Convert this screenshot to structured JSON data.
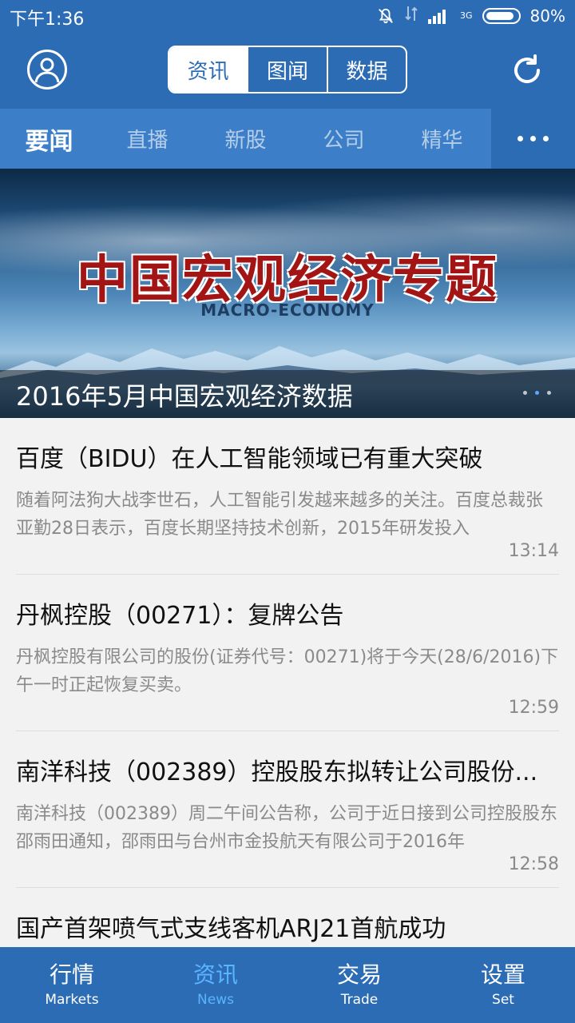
{
  "status_bar": {
    "time": "下午1:36",
    "network": "3G",
    "battery": "80%",
    "icons": [
      "bell-mute-icon",
      "data-arrows-icon",
      "signal-icon",
      "battery-icon"
    ]
  },
  "header": {
    "segments": [
      "资讯",
      "图闻",
      "数据"
    ],
    "active_segment": "资讯",
    "icons": [
      "user-icon",
      "refresh-icon"
    ]
  },
  "categories": {
    "tabs": [
      "要闻",
      "直播",
      "新股",
      "公司",
      "精华"
    ],
    "active_tab": "要闻",
    "more_icon": "more-dots-icon"
  },
  "banner": {
    "title": "中国宏观经济专题",
    "subtitle": "MACRO-ECONOMY",
    "caption": "2016年5月中国宏观经济数据",
    "slide_index": 2,
    "slide_count": 3
  },
  "news": [
    {
      "title": "百度（BIDU）在人工智能领域已有重大突破",
      "summary": "随着阿法狗大战李世石，人工智能引发越来越多的关注。百度总裁张亚勤28日表示，百度长期坚持技术创新，2015年研发投入",
      "time": "13:14"
    },
    {
      "title": "丹枫控股（00271）：复牌公告",
      "summary": "丹枫控股有限公司的股份(证券代号：00271)将于今天(28/6/2016)下午一时正起恢复买卖。",
      "time": "12:59"
    },
    {
      "title": "南洋科技（002389）控股股东拟转让公司股份...",
      "summary": "南洋科技（002389）周二午间公告称，公司于近日接到公司控股股东邵雨田通知，邵雨田与台州市金投航天有限公司于2016年",
      "time": "12:58"
    },
    {
      "title": "国产首架喷气式支线客机ARJ21首航成功",
      "summary": "",
      "time": ""
    }
  ],
  "bottom_nav": [
    {
      "cn": "行情",
      "en": "Markets"
    },
    {
      "cn": "资讯",
      "en": "News"
    },
    {
      "cn": "交易",
      "en": "Trade"
    },
    {
      "cn": "设置",
      "en": "Set"
    }
  ],
  "active_nav": "News",
  "colors": {
    "primary": "#2c6cb5",
    "category_bar": "#3c7fc8",
    "nav_active": "#5ab4ff",
    "banner_title": "#a31515",
    "text_secondary": "#8a8a8a"
  }
}
